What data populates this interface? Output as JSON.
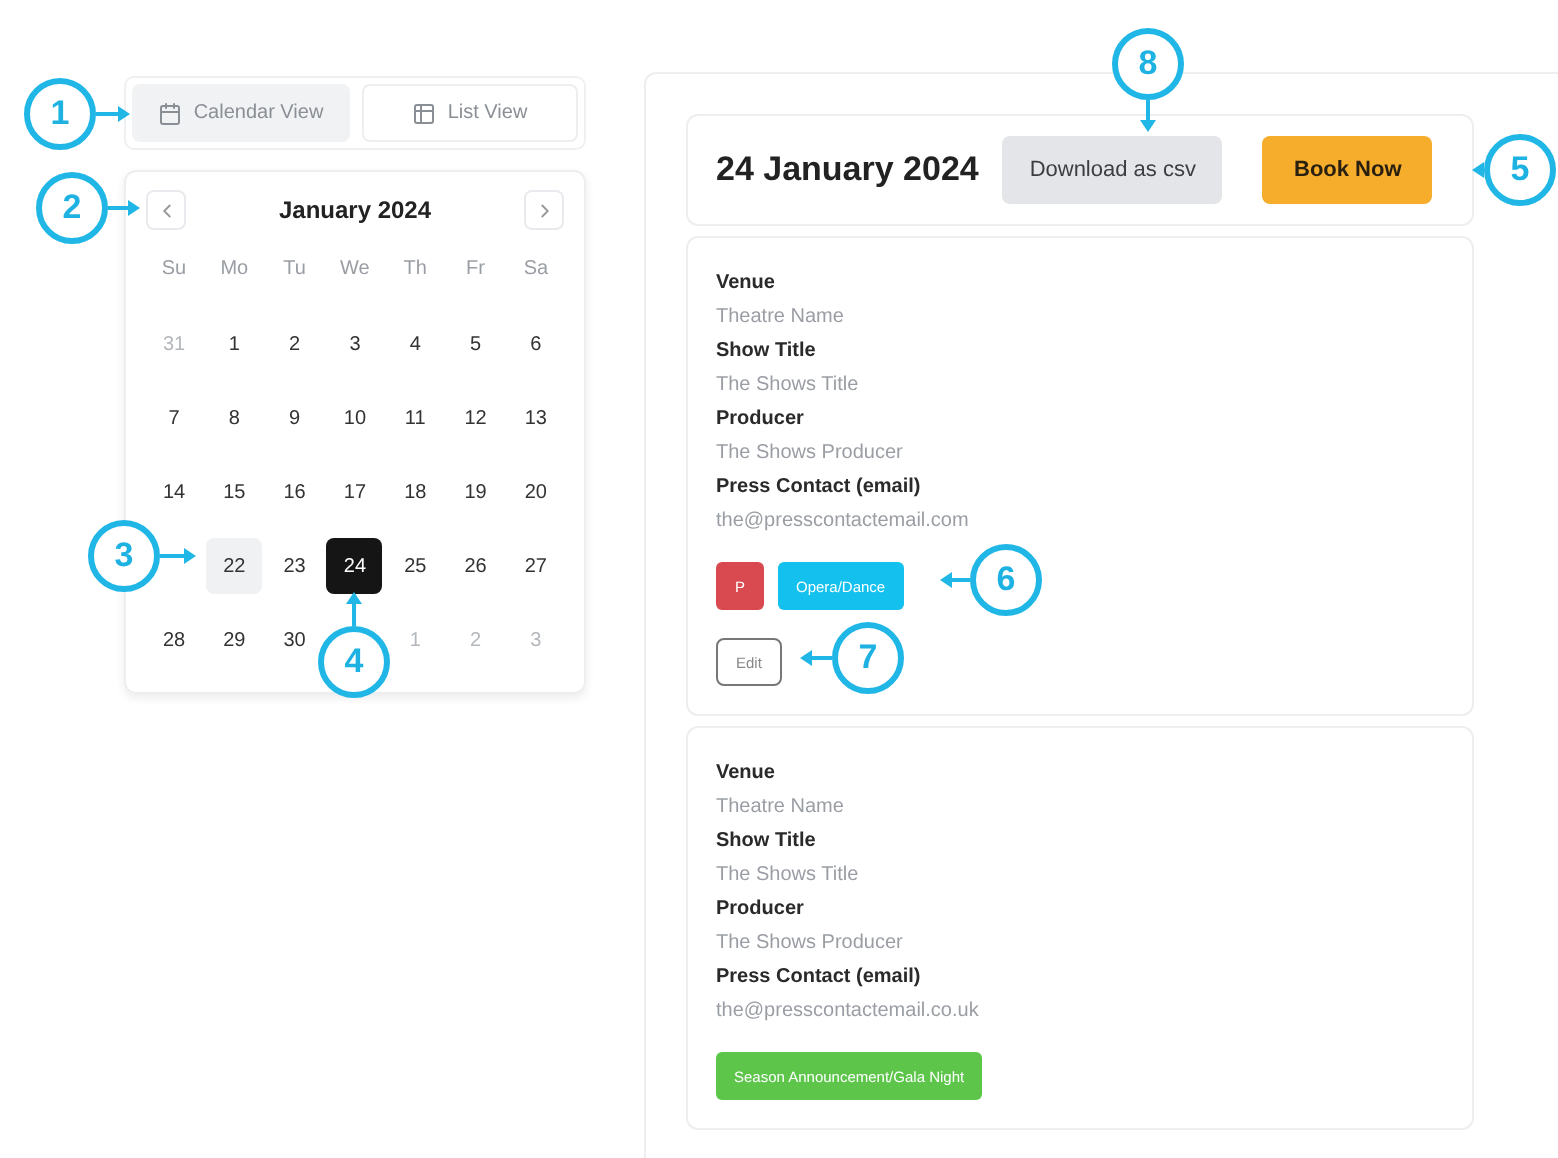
{
  "view_toggle": [
    {
      "label": "Calendar View",
      "selected": true
    },
    {
      "label": "List View",
      "selected": false
    }
  ],
  "calendar": {
    "title": "January 2024",
    "weekdays": [
      "Su",
      "Mo",
      "Tu",
      "We",
      "Th",
      "Fr",
      "Sa"
    ],
    "weeks": [
      [
        {
          "label": "31",
          "kind": "muted",
          "selected": false,
          "today": false
        },
        {
          "label": "1",
          "kind": "normal",
          "selected": false,
          "today": false
        },
        {
          "label": "2",
          "kind": "normal",
          "selected": false,
          "today": false
        },
        {
          "label": "3",
          "kind": "normal",
          "selected": false,
          "today": false
        },
        {
          "label": "4",
          "kind": "normal",
          "selected": false,
          "today": false
        },
        {
          "label": "5",
          "kind": "normal",
          "selected": false,
          "today": false
        },
        {
          "label": "6",
          "kind": "normal",
          "selected": false,
          "today": false
        }
      ],
      [
        {
          "label": "7",
          "kind": "normal",
          "selected": false,
          "today": false
        },
        {
          "label": "8",
          "kind": "normal",
          "selected": false,
          "today": false
        },
        {
          "label": "9",
          "kind": "normal",
          "selected": false,
          "today": false
        },
        {
          "label": "10",
          "kind": "normal",
          "selected": false,
          "today": false
        },
        {
          "label": "11",
          "kind": "normal",
          "selected": false,
          "today": false
        },
        {
          "label": "12",
          "kind": "normal",
          "selected": false,
          "today": false
        },
        {
          "label": "13",
          "kind": "normal",
          "selected": false,
          "today": false
        }
      ],
      [
        {
          "label": "14",
          "kind": "normal",
          "selected": false,
          "today": false
        },
        {
          "label": "15",
          "kind": "normal",
          "selected": false,
          "today": false
        },
        {
          "label": "16",
          "kind": "normal",
          "selected": false,
          "today": false
        },
        {
          "label": "17",
          "kind": "normal",
          "selected": false,
          "today": false
        },
        {
          "label": "18",
          "kind": "normal",
          "selected": false,
          "today": false
        },
        {
          "label": "19",
          "kind": "normal",
          "selected": false,
          "today": false
        },
        {
          "label": "20",
          "kind": "normal",
          "selected": false,
          "today": false
        }
      ],
      [
        {
          "kind": "covered"
        },
        {
          "label": "22",
          "kind": "normal",
          "selected": false,
          "today": true
        },
        {
          "label": "23",
          "kind": "normal",
          "selected": false,
          "today": false
        },
        {
          "label": "24",
          "kind": "normal",
          "selected": true,
          "today": false
        },
        {
          "label": "25",
          "kind": "normal",
          "selected": false,
          "today": false
        },
        {
          "label": "26",
          "kind": "normal",
          "selected": false,
          "today": false
        },
        {
          "label": "27",
          "kind": "normal",
          "selected": false,
          "today": false
        }
      ],
      [
        {
          "label": "28",
          "kind": "normal",
          "selected": false,
          "today": false
        },
        {
          "label": "29",
          "kind": "normal",
          "selected": false,
          "today": false
        },
        {
          "label": "30",
          "kind": "normal",
          "selected": false,
          "today": false
        },
        {
          "kind": "covered"
        },
        {
          "label": "1",
          "kind": "muted",
          "selected": false,
          "today": false
        },
        {
          "label": "2",
          "kind": "muted",
          "selected": false,
          "today": false
        },
        {
          "label": "3",
          "kind": "muted",
          "selected": false,
          "today": false
        }
      ]
    ]
  },
  "day_panel": {
    "title": "24 January 2024",
    "buttons": [
      {
        "label": "Download as csv",
        "kind": "secondary"
      },
      {
        "label": "Book Now",
        "kind": "primary"
      }
    ],
    "events": [
      {
        "fields": [
          {
            "label": "Venue",
            "value": "Theatre Name"
          },
          {
            "label": "Show Title",
            "value": "The Shows Title"
          },
          {
            "label": "Producer",
            "value": "The Shows Producer"
          },
          {
            "label": "Press Contact (email)",
            "value": "the@presscontactemail.com"
          }
        ],
        "tags": [
          {
            "label": "P",
            "color": "#d84a4f"
          },
          {
            "label": "Opera/Dance",
            "color": "#14c1ee"
          }
        ],
        "edit": "Edit"
      },
      {
        "fields": [
          {
            "label": "Venue",
            "value": "Theatre Name"
          },
          {
            "label": "Show Title",
            "value": "The Shows Title"
          },
          {
            "label": "Producer",
            "value": "The Shows Producer"
          },
          {
            "label": "Press Contact (email)",
            "value": "the@presscontactemail.co.uk"
          }
        ],
        "tags": [
          {
            "label": "Season Announcement/Gala Night",
            "color": "#5cc54a"
          }
        ]
      }
    ]
  },
  "callouts": [
    {
      "number": "1"
    },
    {
      "number": "2"
    },
    {
      "number": "3"
    },
    {
      "number": "4"
    },
    {
      "number": "5"
    },
    {
      "number": "6"
    },
    {
      "number": "7"
    },
    {
      "number": "8"
    }
  ]
}
